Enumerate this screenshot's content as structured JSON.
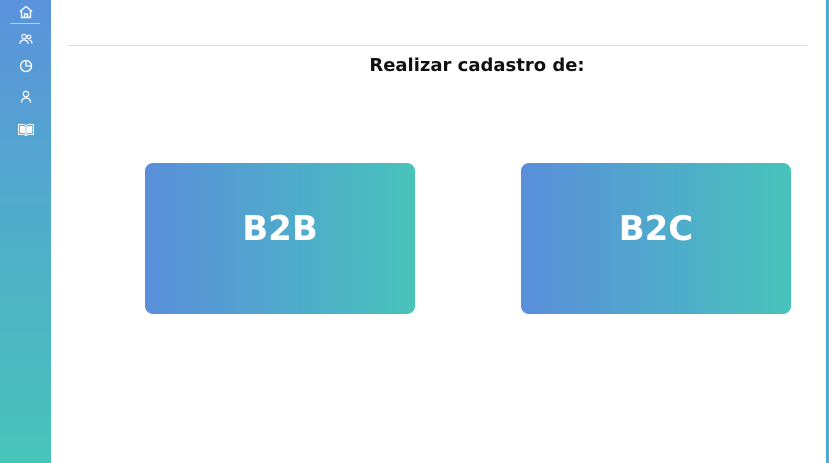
{
  "sidebar": {
    "items": [
      {
        "icon": "home-icon"
      },
      {
        "icon": "users-icon"
      },
      {
        "icon": "pie-chart-icon"
      },
      {
        "icon": "user-icon"
      },
      {
        "icon": "book-icon"
      }
    ]
  },
  "main": {
    "title": "Realizar cadastro de:",
    "options": [
      {
        "label": "B2B"
      },
      {
        "label": "B2C"
      }
    ]
  },
  "colors": {
    "gradient_start": "#5a8edb",
    "gradient_end": "#47c3ba",
    "title_text": "#111111",
    "card_text": "#ffffff"
  }
}
